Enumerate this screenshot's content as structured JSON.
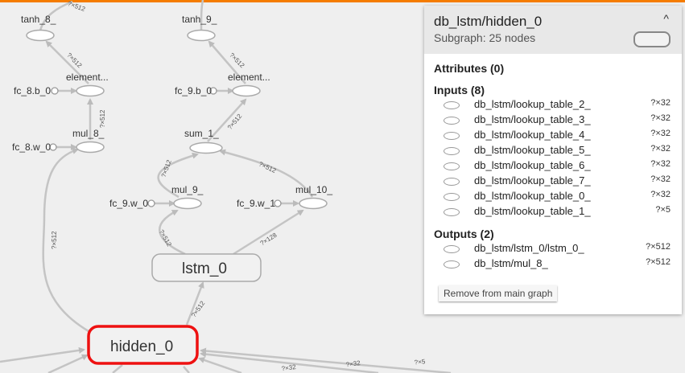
{
  "graph": {
    "nodes": {
      "tanh_8": "tanh_8_",
      "tanh_9": "tanh_9_",
      "element_8": "element...",
      "element_9": "element...",
      "fc_8_b": "fc_8.b_0",
      "fc_9_b": "fc_9.b_0",
      "mul_8": "mul_8_",
      "sum_1": "sum_1_",
      "fc_8_w": "fc_8.w_0",
      "mul_9": "mul_9_",
      "mul_10": "mul_10_",
      "fc_9_w": "fc_9.w_0",
      "fc_9_w1": "fc_9.w_1",
      "lstm_0": "lstm_0",
      "hidden_0": "hidden_0"
    },
    "edge_labels": {
      "top_left": "?×512",
      "e_tanh8": "?×512",
      "e_tanh9": "?×512",
      "e_mul8": "?×512",
      "e_sum1": "?×512",
      "e_mul9_sum": "?×512",
      "e_mul10_sum": "?×512",
      "e_lstm_mul9": "?×512",
      "e_lstm_mul10": "?×128",
      "e_hidden_mul8": "?×512",
      "e_hidden_lstm": "?×512",
      "e_bottom_1": "?×32",
      "e_bottom_2": "?×32",
      "e_bottom_3": "?×5"
    }
  },
  "panel": {
    "title": "db_lstm/hidden_0",
    "subtitle": "Subgraph: 25 nodes",
    "collapse_icon": "^",
    "attributes_label": "Attributes (0)",
    "inputs_label": "Inputs (8)",
    "inputs": [
      {
        "name": "db_lstm/lookup_table_2_",
        "shape": "?×32"
      },
      {
        "name": "db_lstm/lookup_table_3_",
        "shape": "?×32"
      },
      {
        "name": "db_lstm/lookup_table_4_",
        "shape": "?×32"
      },
      {
        "name": "db_lstm/lookup_table_5_",
        "shape": "?×32"
      },
      {
        "name": "db_lstm/lookup_table_6_",
        "shape": "?×32"
      },
      {
        "name": "db_lstm/lookup_table_7_",
        "shape": "?×32"
      },
      {
        "name": "db_lstm/lookup_table_0_",
        "shape": "?×32"
      },
      {
        "name": "db_lstm/lookup_table_1_",
        "shape": "?×5"
      }
    ],
    "outputs_label": "Outputs (2)",
    "outputs": [
      {
        "name": "db_lstm/lstm_0/lstm_0_",
        "shape": "?×512"
      },
      {
        "name": "db_lstm/mul_8_",
        "shape": "?×512"
      }
    ],
    "remove_button": "Remove from main graph"
  }
}
